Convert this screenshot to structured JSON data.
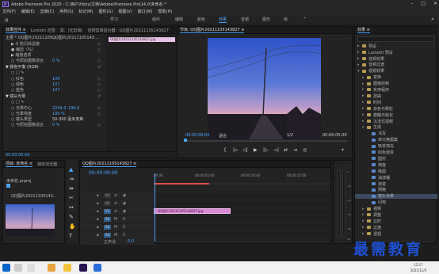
{
  "window": {
    "title": "Adobe Premiere Pro 2020 - C:\\用户\\hbxy\\文档\\Adobe\\Premiere Pro\\14.0\\未命名 *"
  },
  "menu": [
    "文件(F)",
    "编辑(E)",
    "剪辑(C)",
    "序列(S)",
    "标记(M)",
    "图形(G)",
    "视图(V)",
    "窗口(W)",
    "帮助(H)"
  ],
  "workspaces": {
    "items": [
      "学习",
      "组件",
      "编辑",
      "颜色",
      "效果",
      "音频",
      "图形",
      "库"
    ],
    "active": "效果",
    "more": "»"
  },
  "effect_controls": {
    "tabs": [
      "效果控件 ≡",
      "Lumetri 范围",
      "源：(无剪辑)",
      "音频剪辑混合器：QQ图片20211105143827"
    ],
    "source": "主要 * QQ图片20211105...",
    "seq": "QQ图片20211105143...",
    "rows": [
      {
        "label": "▶ ⏱ 防闪烁滤镜",
        "value": ""
      },
      {
        "label": "● 裁剪（%）",
        "value": ""
      },
      {
        "label": "▶ 缩放选项",
        "value": ""
      },
      {
        "label": "○ 与原始图像混合",
        "value": "0 %"
      },
      {
        "label": "▼ 颜色平衡 (RGB)",
        "value": ""
      },
      {
        "label": "○ □ ✎",
        "value": ""
      },
      {
        "label": "○ 红色",
        "value": "100"
      },
      {
        "label": "○ 绿色",
        "value": "107"
      },
      {
        "label": "○ 蓝色",
        "value": "107"
      },
      {
        "label": "▼ 镜头光晕",
        "value": ""
      },
      {
        "label": "○ □ ✎",
        "value": ""
      },
      {
        "label": "○ 光晕中心",
        "value": "2244.0",
        "value2": "190.0"
      },
      {
        "label": "○ 光晕亮度",
        "value": "100 %"
      },
      {
        "label": "○ 镜头类型",
        "value": "50-300 毫米变焦"
      },
      {
        "label": "○ 与原始图像混合",
        "value": "0 %"
      }
    ],
    "clip_label": "QQ图片20211105143827.jpg",
    "timecode": "00:00:00:00"
  },
  "program": {
    "title": "节目: QQ图片20211105143827 ≡",
    "timecode_in": "00:00:00:00",
    "fit": "适合",
    "resolution": "1/2",
    "timecode_out": "00:00:05:00",
    "buttons": [
      "{",
      "|←",
      "◁|",
      "▶",
      "|▷",
      "→|",
      "⇄",
      "⇥",
      "◎",
      "+"
    ]
  },
  "effects": {
    "title": "效果 ≡",
    "items": [
      {
        "label": "预设",
        "type": "folder"
      },
      {
        "label": "Lumetri 预设",
        "type": "folder"
      },
      {
        "label": "音频效果",
        "type": "folder"
      },
      {
        "label": "音频过渡",
        "type": "folder"
      },
      {
        "label": "视频效果",
        "type": "folder"
      },
      {
        "label": "变换",
        "type": "folder"
      },
      {
        "label": "图像控制",
        "type": "folder"
      },
      {
        "label": "实用程序",
        "type": "folder"
      },
      {
        "label": "扭曲",
        "type": "folder"
      },
      {
        "label": "时间",
        "type": "folder"
      },
      {
        "label": "杂色与颗粒",
        "type": "folder"
      },
      {
        "label": "模糊与锐化",
        "type": "folder"
      },
      {
        "label": "沉浸式视频",
        "type": "folder"
      },
      {
        "label": "生成",
        "type": "folder"
      },
      {
        "label": "书写",
        "type": "effect"
      },
      {
        "label": "单元格图案",
        "type": "effect"
      },
      {
        "label": "吸管填充",
        "type": "effect"
      },
      {
        "label": "四色渐变",
        "type": "effect"
      },
      {
        "label": "圆形",
        "type": "effect"
      },
      {
        "label": "棋盘",
        "type": "effect"
      },
      {
        "label": "椭圆",
        "type": "effect"
      },
      {
        "label": "油漆桶",
        "type": "effect"
      },
      {
        "label": "渐变",
        "type": "effect"
      },
      {
        "label": "网格",
        "type": "effect"
      },
      {
        "label": "镜头光晕",
        "type": "effect",
        "selected": true
      },
      {
        "label": "闪电",
        "type": "effect"
      },
      {
        "label": "视频",
        "type": "folder"
      },
      {
        "label": "调整",
        "type": "folder"
      },
      {
        "label": "过时",
        "type": "folder"
      },
      {
        "label": "过渡",
        "type": "folder"
      },
      {
        "label": "透视",
        "type": "folder"
      }
    ]
  },
  "project": {
    "tabs": [
      "项目: 未命名 ≡",
      "媒体浏览器",
      "库"
    ],
    "file": "未命名.prproj",
    "item": "QQ图片20211105143...",
    "duration": "5:00"
  },
  "timeline": {
    "title": "QQ图片20211105143827 ≡",
    "timecode": "00:00:00:00",
    "ruler": [
      "00:00",
      "00:00:05:00",
      "00:00:10:00",
      "00:00:15:00"
    ],
    "tracks": [
      "V3",
      "V2",
      "V1",
      "A1",
      "A2",
      "A3"
    ],
    "master": "主声道",
    "master_val": "0.0",
    "clip": "QQ图片20211105143827.jpg"
  },
  "meters": {
    "scale": [
      "0",
      "-12",
      "-24",
      "-36",
      "-48",
      "dB"
    ]
  },
  "watermark": "最需教育",
  "clock": {
    "time": "15:17",
    "date": "2021/11/5"
  }
}
